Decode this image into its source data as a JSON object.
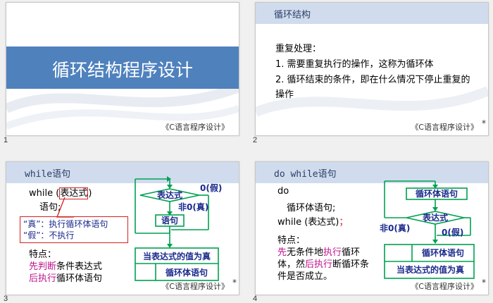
{
  "slides": [
    {
      "number": "1",
      "title": "循环结构程序设计",
      "footer": "《C语言程序设计》"
    },
    {
      "number": "2",
      "heading": "循环结构",
      "lines": [
        "重复处理：",
        "1. 需要重复执行的操作，这称为循环体",
        "2. 循环结束的条件，即在什么情况下停止重复的",
        "操作"
      ],
      "footer": "《C语言程序设计》",
      "star": "*"
    },
    {
      "number": "3",
      "heading": "while语句",
      "code": {
        "kw": "while",
        "open": " (",
        "expr": "表达式",
        "close": ")",
        "body": "语句;"
      },
      "callout": {
        "line1": "“真”：执行循环体语句",
        "line2": "“假”：不执行"
      },
      "features": {
        "label": "特点：",
        "l1a": "先判断",
        "l1b": "条件表达式",
        "l2a": "后执行",
        "l2b": "循环体语句"
      },
      "flow": {
        "cond": "表达式",
        "false_label": "0(假)",
        "true_label": "非0(真)",
        "stmt": "语句",
        "nsd_top": "当表达式的值为真",
        "nsd_body": "循环体语句"
      },
      "footer": "《C语言程序设计》",
      "star": "*"
    },
    {
      "number": "4",
      "heading": "do while语句",
      "code": {
        "l1": "do",
        "l2": "循环体语句;",
        "l3": "while (表达式)",
        "semi": "；"
      },
      "features": {
        "label": "特点：",
        "p1": "先",
        "p2": "无条件地",
        "p3": "执行",
        "p4": "循环",
        "p5": "体，然",
        "p6": "后执行",
        "p7": "断循环条",
        "p8": "件是否成立。"
      },
      "flow": {
        "stmt": "循环体语句",
        "cond": "表达式",
        "true_label": "非0(真)",
        "false_label": "0(假)",
        "nsd_body": "循环体语句",
        "nsd_bottom": "当表达式的值为真"
      },
      "footer": "《C语言程序设计》",
      "star": "*"
    }
  ],
  "colors": {
    "blue_band": "#4f81bd",
    "green": "#00a050",
    "red": "#d42020",
    "purple": "#c0148c",
    "navy": "#1a2a8c"
  }
}
